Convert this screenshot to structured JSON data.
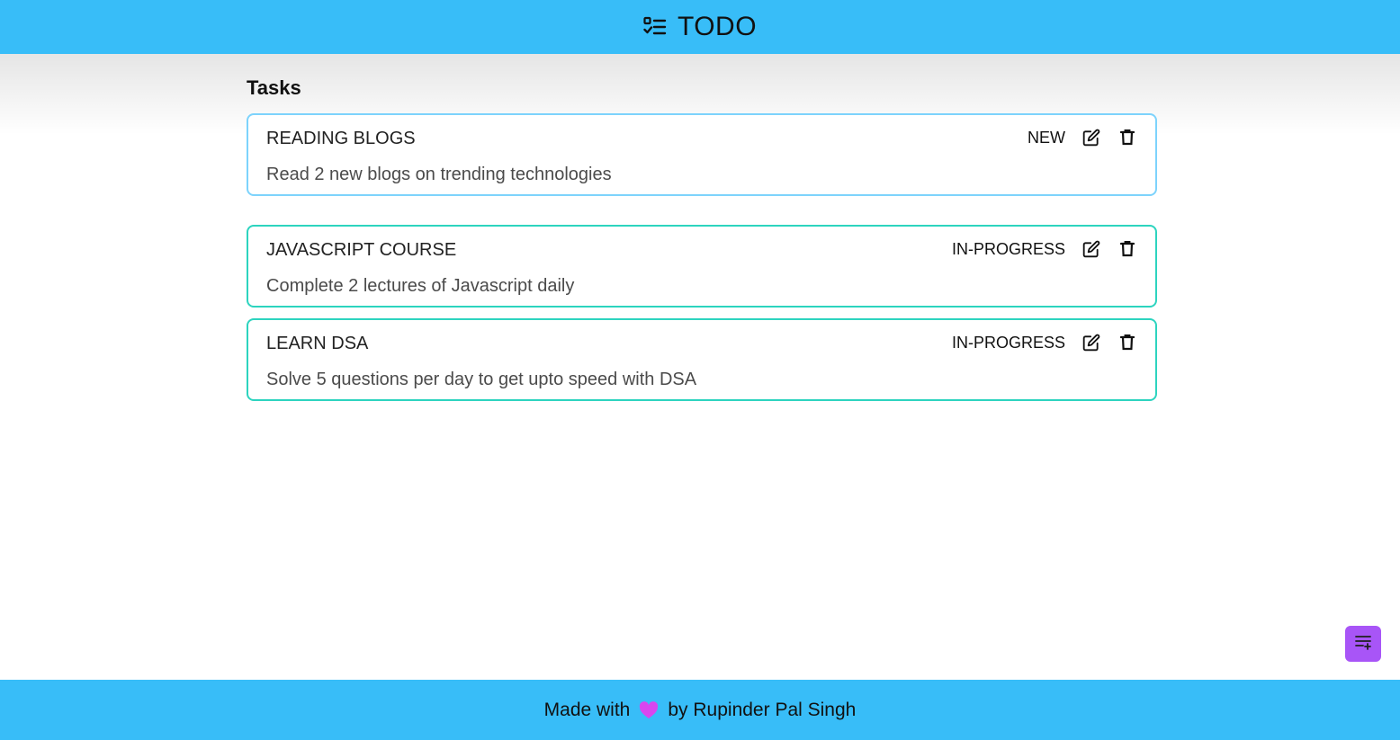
{
  "header": {
    "title": "TODO",
    "icon": "checklist-icon"
  },
  "main": {
    "section_title": "Tasks",
    "tasks": [
      {
        "title": "READING BLOGS",
        "description": "Read 2 new blogs on trending technologies",
        "status": "NEW",
        "border_color": "#7dd3fc"
      },
      {
        "title": "JAVASCRIPT COURSE",
        "description": "Complete 2 lectures of Javascript daily",
        "status": "IN-PROGRESS",
        "border_color": "#2dd4bf"
      },
      {
        "title": "LEARN DSA",
        "description": "Solve 5 questions per day to get upto speed with DSA",
        "status": "IN-PROGRESS",
        "border_color": "#2dd4bf"
      }
    ],
    "icons": {
      "edit": "edit-icon",
      "delete": "trash-icon"
    }
  },
  "fab": {
    "icon": "add-task-icon",
    "color": "#a855f7"
  },
  "footer": {
    "prefix": "Made with",
    "suffix": "by Rupinder Pal Singh",
    "heart_color": "#d946ef"
  },
  "colors": {
    "header_bg": "#38bdf8",
    "footer_bg": "#38bdf8"
  }
}
